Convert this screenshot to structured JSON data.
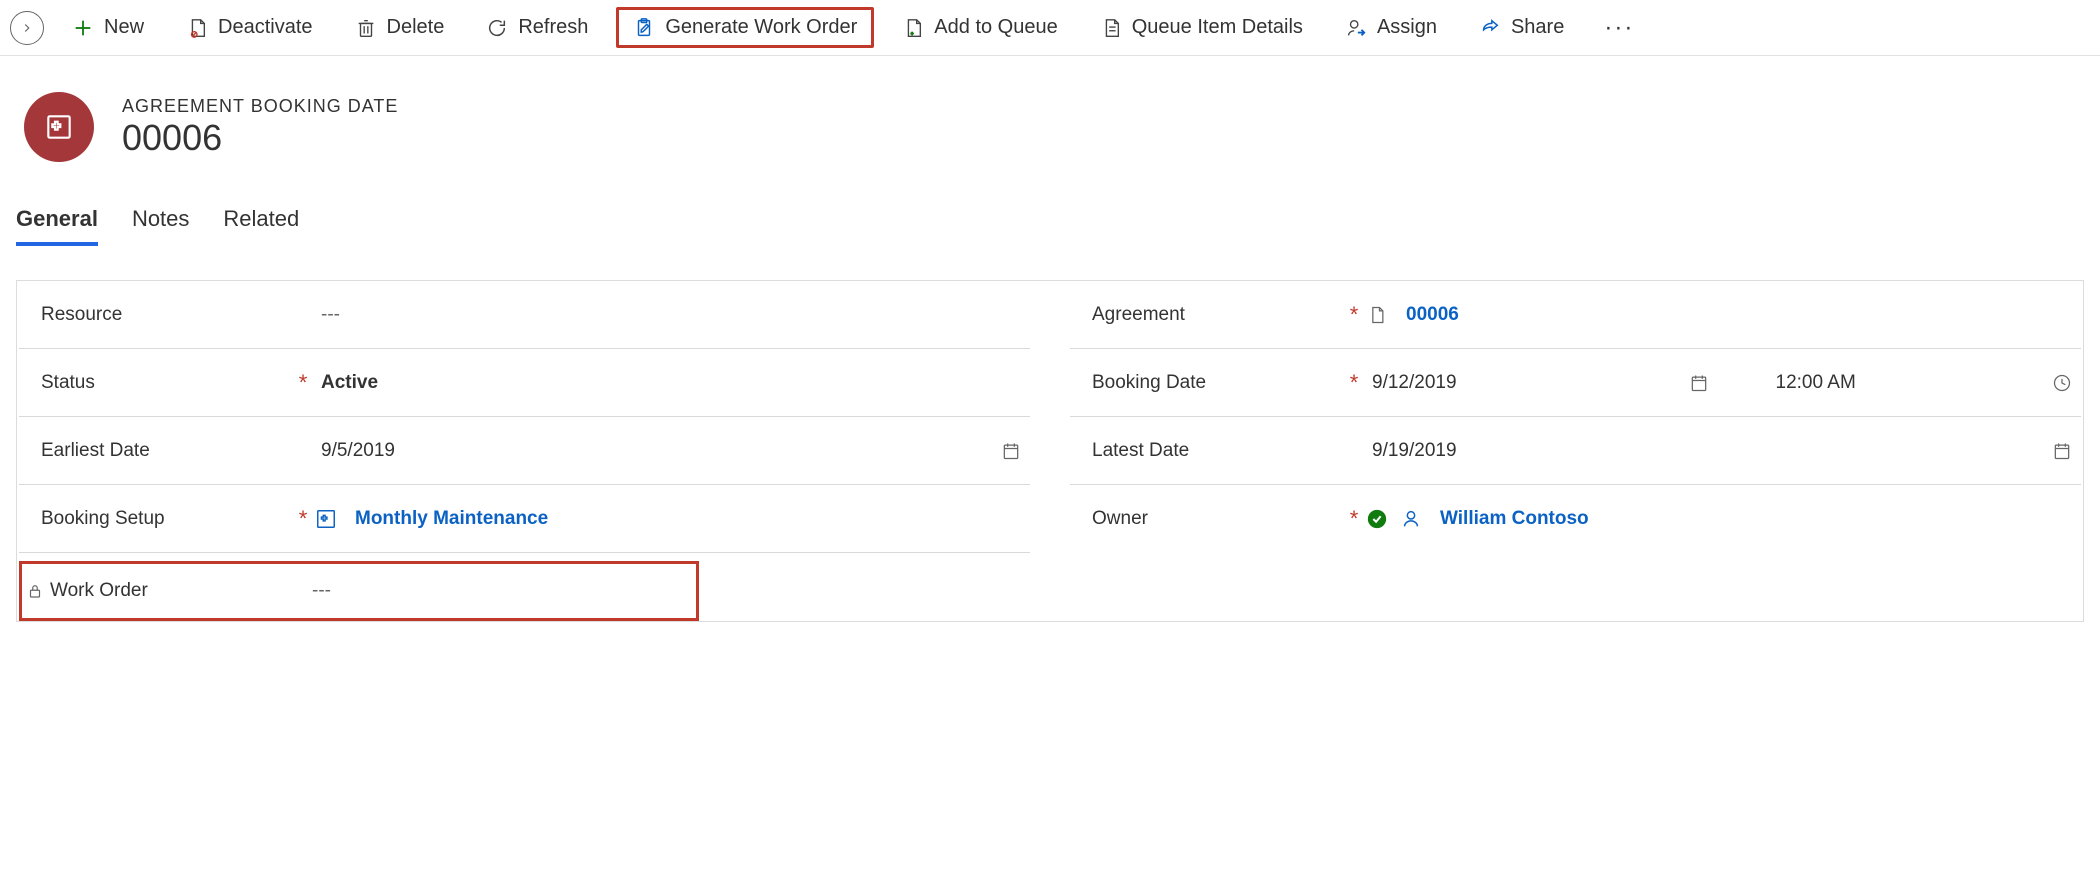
{
  "commandBar": {
    "new": "New",
    "deactivate": "Deactivate",
    "delete": "Delete",
    "refresh": "Refresh",
    "generateWorkOrder": "Generate Work Order",
    "addToQueue": "Add to Queue",
    "queueItemDetails": "Queue Item Details",
    "assign": "Assign",
    "share": "Share"
  },
  "header": {
    "entityLabel": "AGREEMENT BOOKING DATE",
    "recordTitle": "00006"
  },
  "tabs": {
    "general": "General",
    "notes": "Notes",
    "related": "Related"
  },
  "fields": {
    "resource": {
      "label": "Resource",
      "value": "---"
    },
    "status": {
      "label": "Status",
      "value": "Active"
    },
    "earliestDate": {
      "label": "Earliest Date",
      "value": "9/5/2019"
    },
    "bookingSetup": {
      "label": "Booking Setup",
      "value": "Monthly Maintenance"
    },
    "workOrder": {
      "label": "Work Order",
      "value": "---"
    },
    "agreement": {
      "label": "Agreement",
      "value": "00006"
    },
    "bookingDate": {
      "label": "Booking Date",
      "date": "9/12/2019",
      "time": "12:00 AM"
    },
    "latestDate": {
      "label": "Latest Date",
      "value": "9/19/2019"
    },
    "owner": {
      "label": "Owner",
      "value": "William Contoso"
    }
  }
}
